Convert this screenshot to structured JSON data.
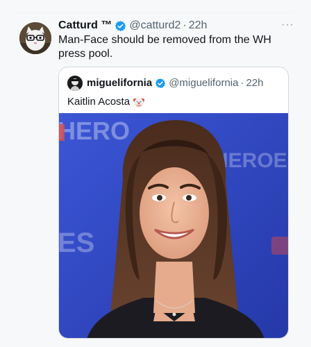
{
  "tweet": {
    "author_name": "Catturd ™",
    "handle": "@catturd2",
    "separator": "·",
    "time": "22h",
    "text": "Man-Face should be removed from the WH press pool.",
    "more_icon": "more-horizontal-icon"
  },
  "quote": {
    "author_name": "miguelifornia",
    "handle": "@miguelifornia",
    "separator": "·",
    "time": "22h",
    "text": "Kaitlin Acosta",
    "emoji_icon": "clown-face-icon",
    "media_backdrop_text": [
      "HERO",
      "HEROES",
      "ES"
    ]
  },
  "colors": {
    "verified": "#1d9bf0",
    "secondary_text": "#536471",
    "card_border": "#cfd9de",
    "backdrop_blue": "#2f47c8"
  }
}
